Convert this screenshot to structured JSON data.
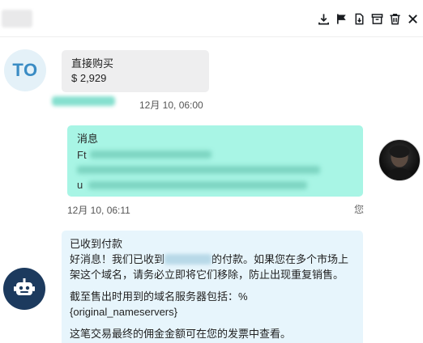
{
  "toolbar": {
    "icons": [
      "download-icon",
      "flag-icon",
      "export-file-icon",
      "archive-icon",
      "trash-icon",
      "close-icon"
    ]
  },
  "messages": {
    "buy": {
      "avatar_initials": "TO",
      "label": "直接购买",
      "amount": "$ 2,929",
      "timestamp": "12月 10, 06:00"
    },
    "user_msg": {
      "label": "消息",
      "text_fragment_1": "Ft",
      "text_fragment_2": "u",
      "timestamp": "12月 10, 06:11",
      "read_status": "您"
    },
    "bot": {
      "title": "已收到付款",
      "line1_start": "好消息！我们已收到",
      "line1_end": "的付款。如果您在多个市场上架这个域名，请务必立即将它们移除，防止出现重复销售。",
      "line2": "截至售出时用到的域名服务器包括：%{original_nameservers}",
      "line3": "这笔交易最终的佣金金额可在您的发票中查看。"
    }
  },
  "colors": {
    "accent_teal": "#a8f5e5",
    "bot_bubble": "#e7f5fc",
    "bot_avatar": "#1c3a5e",
    "initials_text": "#3a8cc4"
  }
}
